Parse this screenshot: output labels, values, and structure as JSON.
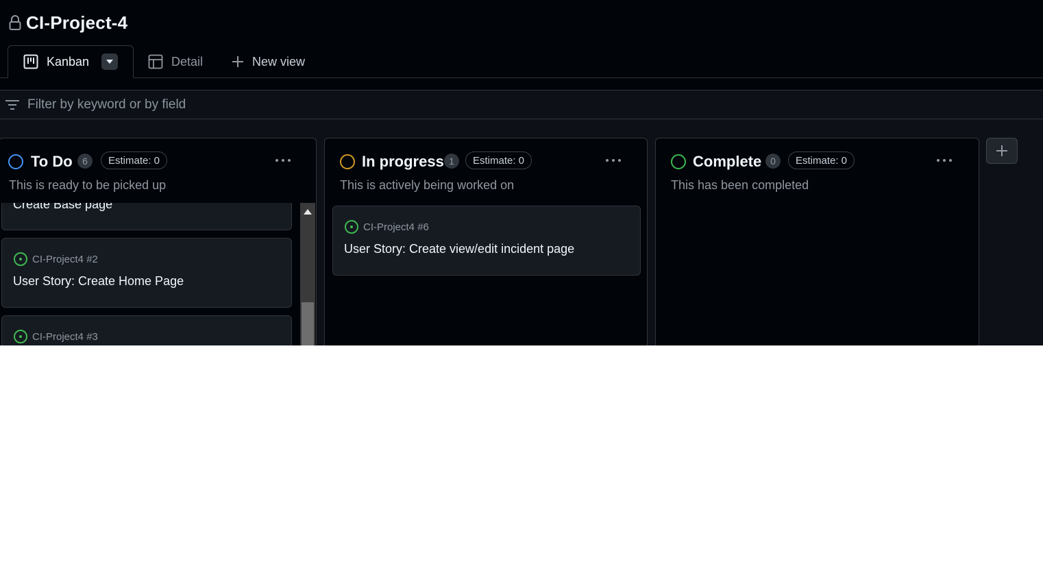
{
  "project": {
    "title": "CI-Project-4"
  },
  "tabs": [
    {
      "label": "Kanban",
      "active": true
    },
    {
      "label": "Detail"
    },
    {
      "label": "New view"
    }
  ],
  "filter": {
    "placeholder": "Filter by keyword or by field"
  },
  "columns": [
    {
      "name": "To Do",
      "count": "6",
      "estimate": "Estimate: 0",
      "description": "This is ready to be picked up",
      "status_color": "#4493f8",
      "cards": [
        {
          "meta": "",
          "title": "Create Base page"
        },
        {
          "meta": "CI-Project4 #2",
          "title": "User Story: Create Home Page"
        },
        {
          "meta": "CI-Project4 #3",
          "title": ""
        }
      ]
    },
    {
      "name": "In progress",
      "count": "1",
      "estimate": "Estimate: 0",
      "description": "This is actively being worked on",
      "status_color": "#d29922",
      "cards": [
        {
          "meta": "CI-Project4 #6",
          "title": "User Story: Create view/edit incident page"
        }
      ]
    },
    {
      "name": "Complete",
      "count": "0",
      "estimate": "Estimate: 0",
      "description": "This has been completed",
      "status_color": "#3fb950",
      "cards": []
    }
  ],
  "colors": {
    "open_issue": "#3fb950",
    "background": "#010409",
    "surface": "#0d1117",
    "card": "#161b22",
    "border": "#30363d"
  }
}
